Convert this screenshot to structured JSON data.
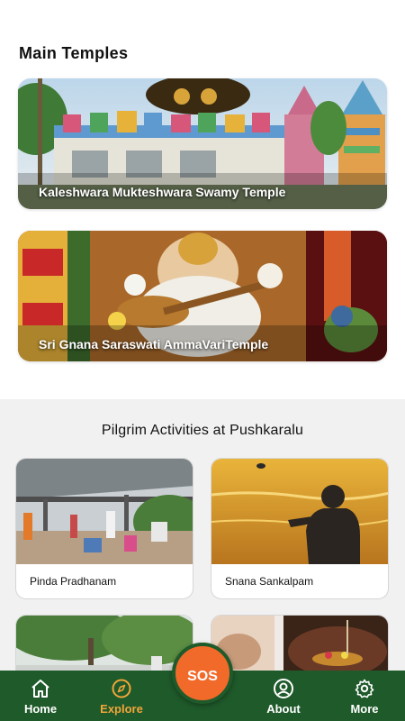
{
  "main_temples": {
    "title": "Main Temples",
    "cards": [
      {
        "caption": "Kaleshwara Mukteshwara Swamy Temple"
      },
      {
        "caption": "Sri Gnana Saraswati AmmaVariTemple"
      }
    ]
  },
  "activities": {
    "title": "Pilgrim Activities at Pushkaralu",
    "cards": [
      {
        "label": "Pinda Pradhanam"
      },
      {
        "label": "Snana Sankalpam"
      },
      {
        "label": ""
      },
      {
        "label": ""
      }
    ]
  },
  "nav": {
    "items": [
      {
        "label": "Home",
        "icon": "home-icon"
      },
      {
        "label": "Explore",
        "icon": "compass-icon",
        "active": true
      },
      {
        "label": "About",
        "icon": "user-circle-icon"
      },
      {
        "label": "More",
        "icon": "gear-icon"
      }
    ],
    "sos_label": "SOS"
  },
  "colors": {
    "nav_background": "#1f5a2a",
    "nav_active": "#f0a53a",
    "sos": "#f26a2a",
    "section_background": "#f1f1f1"
  }
}
